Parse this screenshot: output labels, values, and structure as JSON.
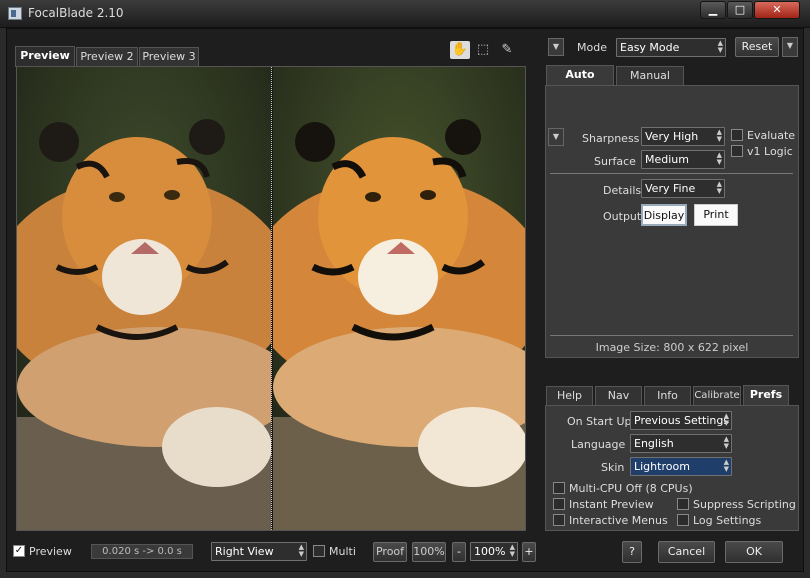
{
  "window": {
    "title": "FocalBlade 2.10",
    "minimize": "▁",
    "maximize": "□",
    "close": "✕"
  },
  "preview_tabs": [
    "Preview 1",
    "Preview 2",
    "Preview 3"
  ],
  "mode": {
    "label": "Mode",
    "value": "Easy Mode",
    "reset": "Reset"
  },
  "mode_tabs": [
    "Auto",
    "Manual"
  ],
  "settings": {
    "sharpness_label": "Sharpness",
    "sharpness": "Very High",
    "surface_label": "Surface",
    "surface": "Medium",
    "details_label": "Details",
    "details": "Very Fine",
    "output_label": "Output",
    "output_display": "Display",
    "output_print": "Print",
    "evaluate": "Evaluate",
    "v1_logic": "v1 Logic",
    "image_size": "Image Size:  800 x 622 pixel"
  },
  "pref_tabs": [
    "Help",
    "Nav",
    "Info",
    "Calibrate",
    "Prefs"
  ],
  "prefs": {
    "on_start_label": "On Start Up",
    "on_start": "Previous Settings",
    "language_label": "Language",
    "language": "English",
    "skin_label": "Skin",
    "skin": "Lightroom",
    "multi_cpu": "Multi-CPU Off (8 CPUs)",
    "instant_preview": "Instant Preview",
    "suppress_scripting": "Suppress Scripting",
    "interactive_menus": "Interactive Menus",
    "log_settings": "Log Settings"
  },
  "bottom": {
    "preview_label": "Preview",
    "timing": "0.020 s -> 0.0 s",
    "view": "Right View",
    "multi": "Multi",
    "proof": "Proof",
    "zoom_fixed": "100%",
    "minus": "-",
    "zoom": "100%",
    "plus": "+",
    "help": "?",
    "cancel": "Cancel",
    "ok": "OK"
  },
  "colors": {
    "accent_select": "#1f3f6a",
    "panel": "#3a3a3a",
    "background": "#1e1e1e"
  }
}
